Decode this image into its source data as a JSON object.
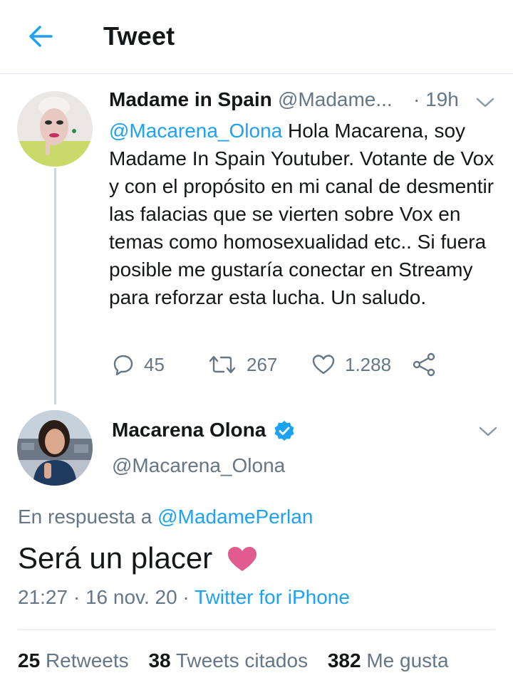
{
  "header": {
    "title": "Tweet",
    "back_icon": "arrow-left-icon",
    "accent": "#1da1f2"
  },
  "parent_tweet": {
    "name": "Madame in Spain",
    "handle": "@Madame...",
    "time": "· 19h",
    "mention": "@Macarena_Olona",
    "text": " Hola Macarena, soy Madame In Spain Youtuber. Votante de Vox y con el propósito en mi canal de desmentir las falacias que se vierten sobre Vox en temas como homosexualidad etc.. Si fuera posible me gustaría conectar en Streamy para reforzar esta lucha. Un saludo.",
    "actions": {
      "replies": "45",
      "retweets": "267",
      "likes": "1.288"
    }
  },
  "main_tweet": {
    "name": "Macarena Olona",
    "handle": "@Macarena_Olona",
    "reply_prefix": "En respuesta a",
    "reply_to": "@MadamePerlan",
    "text": "Será un placer",
    "timestamp": "21:27 · 16 nov. 20 ·",
    "source": "Twitter for iPhone",
    "stats": {
      "retweets_count": "25",
      "retweets_label": "Retweets",
      "quotes_count": "38",
      "quotes_label": "Tweets citados",
      "likes_count": "382",
      "likes_label": "Me gusta"
    }
  }
}
